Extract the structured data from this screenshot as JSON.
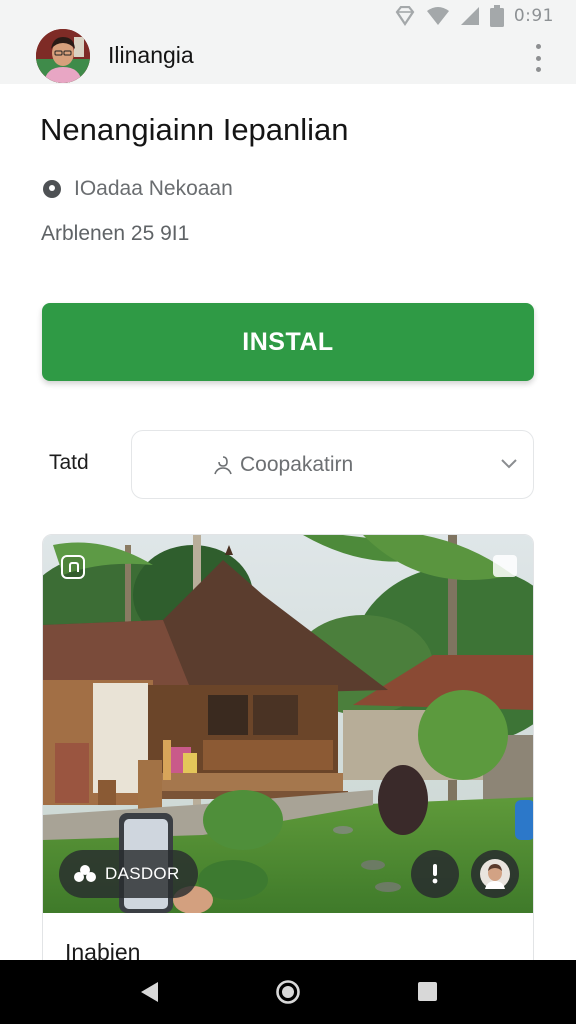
{
  "status_bar": {
    "time": "0:91",
    "icons": [
      "diamond-icon",
      "wifi-icon",
      "cell-signal-icon",
      "battery-icon"
    ]
  },
  "header": {
    "app_title": "Ilinangia",
    "avatar": "user-avatar",
    "menu_icon": "overflow-menu-icon"
  },
  "main": {
    "page_title": "Nenangiainn Iepanlian",
    "location_icon": "location-pin-icon",
    "location": "IOadaa Nekoaan",
    "details": "Arblenen 25 9I1",
    "install_button": "INSTAL",
    "select_label": "Tatd",
    "select_icon": "user-icon",
    "select_value": "Coopakatirn",
    "select_chevron": "chevron-down-icon"
  },
  "card": {
    "image": "tropical-house-garden-photo",
    "chip_icon": "cloud-group-icon",
    "chip_label": "DASDOR",
    "more_icon": "more-vertical-icon",
    "face_icon": "profile-avatar-icon",
    "caption": "Inabien"
  },
  "nav_bar": {
    "back": "back-icon",
    "home": "home-icon",
    "recents": "recents-icon"
  },
  "colors": {
    "accent_green": "#2f9a45",
    "top_bar_bg": "#f3f4f4",
    "nav_bar_bg": "#000000"
  }
}
